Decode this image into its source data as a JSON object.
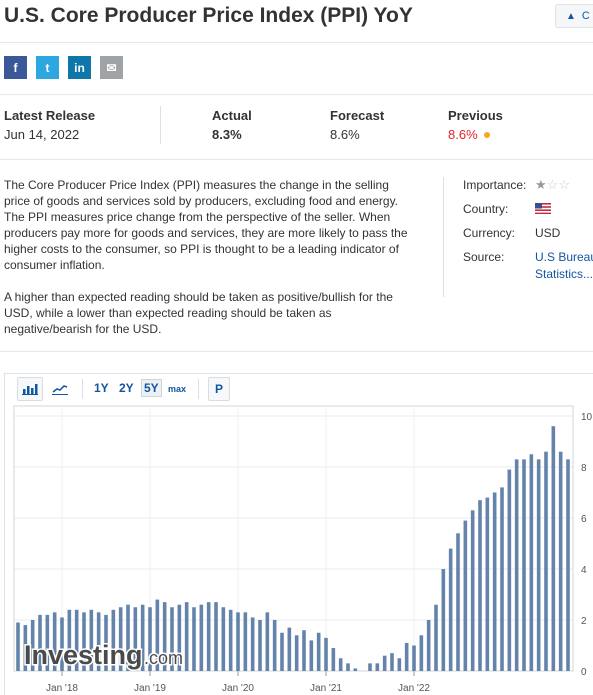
{
  "page": {
    "title": "U.S. Core Producer Price Index (PPI) YoY",
    "alert_button_label": "C"
  },
  "share": [
    {
      "name": "facebook",
      "icon": "facebook-icon",
      "color": "#3b5998",
      "glyph": "f"
    },
    {
      "name": "twitter",
      "icon": "twitter-icon",
      "color": "#2ca7e0",
      "glyph": "t"
    },
    {
      "name": "linkedin",
      "icon": "linkedin-icon",
      "color": "#0e76a8",
      "glyph": "in"
    },
    {
      "name": "email",
      "icon": "email-icon",
      "color": "#a0a3a6",
      "glyph": "✉"
    }
  ],
  "release": {
    "latest_label": "Latest Release",
    "latest_date": "Jun 14, 2022",
    "actual_label": "Actual",
    "actual_value": "8.3%",
    "forecast_label": "Forecast",
    "forecast_value": "8.6%",
    "previous_label": "Previous",
    "previous_value": "8.6%"
  },
  "description": {
    "p1": "The Core Producer Price Index (PPI) measures the change in the selling price of goods and services sold by producers, excluding food and energy. The PPI measures price change from the perspective of the seller. When producers pay more for goods and services, they are more likely to pass the higher costs to the consumer, so PPI is thought to be a leading indicator of consumer inflation.",
    "p2": "A higher than expected reading should be taken as positive/bullish for the USD, while a lower than expected reading should be taken as negative/bearish for the USD."
  },
  "meta": {
    "importance_label": "Importance:",
    "importance_stars": 1,
    "country_label": "Country:",
    "country_icon": "us-flag-icon",
    "currency_label": "Currency:",
    "currency_value": "USD",
    "source_label": "Source:",
    "source_line1": "U.S Bureau",
    "source_line2": "Statistics..."
  },
  "toolbar": {
    "bar_icon": "bar-chart-icon",
    "line_icon": "line-chart-icon",
    "timeframes": [
      "1Y",
      "2Y",
      "5Y",
      "max"
    ],
    "active_timeframe": "5Y",
    "p_label": "P"
  },
  "watermark": {
    "brand": "Investing",
    "suffix": ".com"
  },
  "colors": {
    "bar": "#6383ab",
    "accent": "#1256a0",
    "red": "#e3242b",
    "orange_dot": "#f5a623"
  },
  "chart_data": {
    "type": "bar",
    "ylim": [
      0,
      10
    ],
    "yticks": [
      0,
      2,
      4,
      6,
      8,
      10
    ],
    "xticks": [
      {
        "label": "Jan '18",
        "index": 6
      },
      {
        "label": "Jan '19",
        "index": 18
      },
      {
        "label": "Jan '20",
        "index": 30
      },
      {
        "label": "Jan '21",
        "index": 42
      },
      {
        "label": "Jan '22",
        "index": 54
      }
    ],
    "values": [
      1.9,
      1.8,
      2.0,
      2.2,
      2.2,
      2.3,
      2.1,
      2.4,
      2.4,
      2.3,
      2.4,
      2.3,
      2.2,
      2.4,
      2.5,
      2.6,
      2.5,
      2.6,
      2.5,
      2.8,
      2.7,
      2.5,
      2.6,
      2.7,
      2.5,
      2.6,
      2.7,
      2.7,
      2.5,
      2.4,
      2.3,
      2.3,
      2.1,
      2.0,
      2.3,
      2.0,
      1.5,
      1.7,
      1.4,
      1.6,
      1.2,
      1.5,
      1.3,
      0.9,
      0.5,
      0.3,
      0.1,
      0.0,
      0.3,
      0.3,
      0.6,
      0.7,
      0.5,
      1.1,
      1.0,
      1.4,
      2.0,
      2.6,
      4.0,
      4.8,
      5.4,
      5.9,
      6.3,
      6.7,
      6.8,
      7.0,
      7.2,
      7.9,
      8.3,
      8.3,
      8.5,
      8.3,
      8.6,
      9.6,
      8.6,
      8.3
    ]
  }
}
